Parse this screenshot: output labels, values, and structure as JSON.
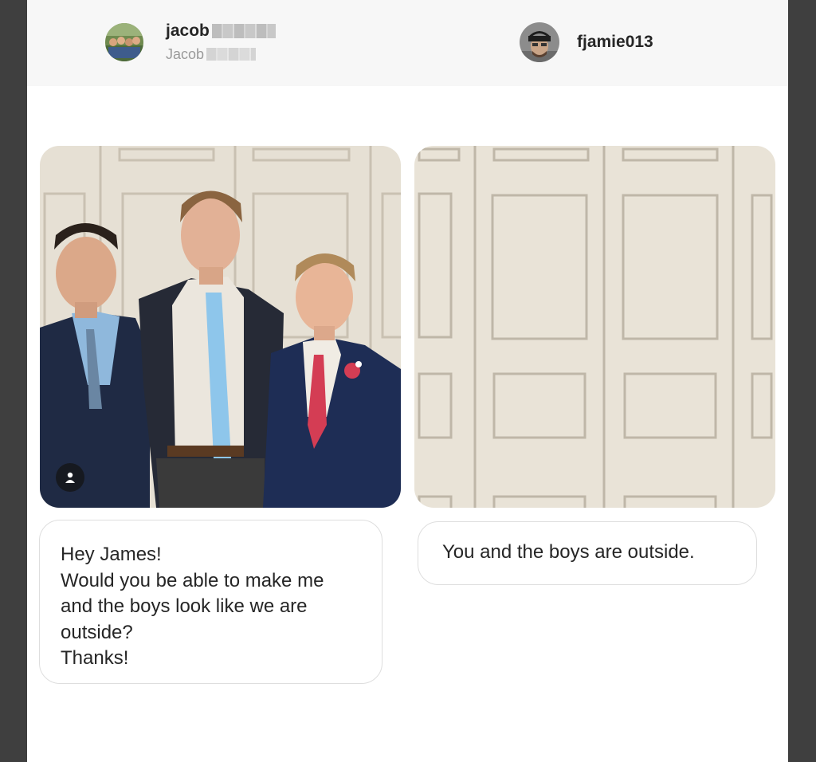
{
  "left_user": {
    "username": "jacob",
    "full_name": "Jacob",
    "avatar_icon": "group-photo-avatar"
  },
  "right_user": {
    "username": "fjamie013",
    "avatar_icon": "man-with-cap-avatar"
  },
  "left_post": {
    "image_desc_icon": "person-tag-icon",
    "caption_lines": [
      "Hey James!",
      "Would you be able to make me",
      "and the boys look like we are",
      "outside?",
      "Thanks!"
    ]
  },
  "right_post": {
    "caption": "You and the boys are outside."
  },
  "colors": {
    "page_bg": "#3f3f3f",
    "header_bg": "#f7f7f7",
    "door_panel": "#e8e2d6"
  }
}
